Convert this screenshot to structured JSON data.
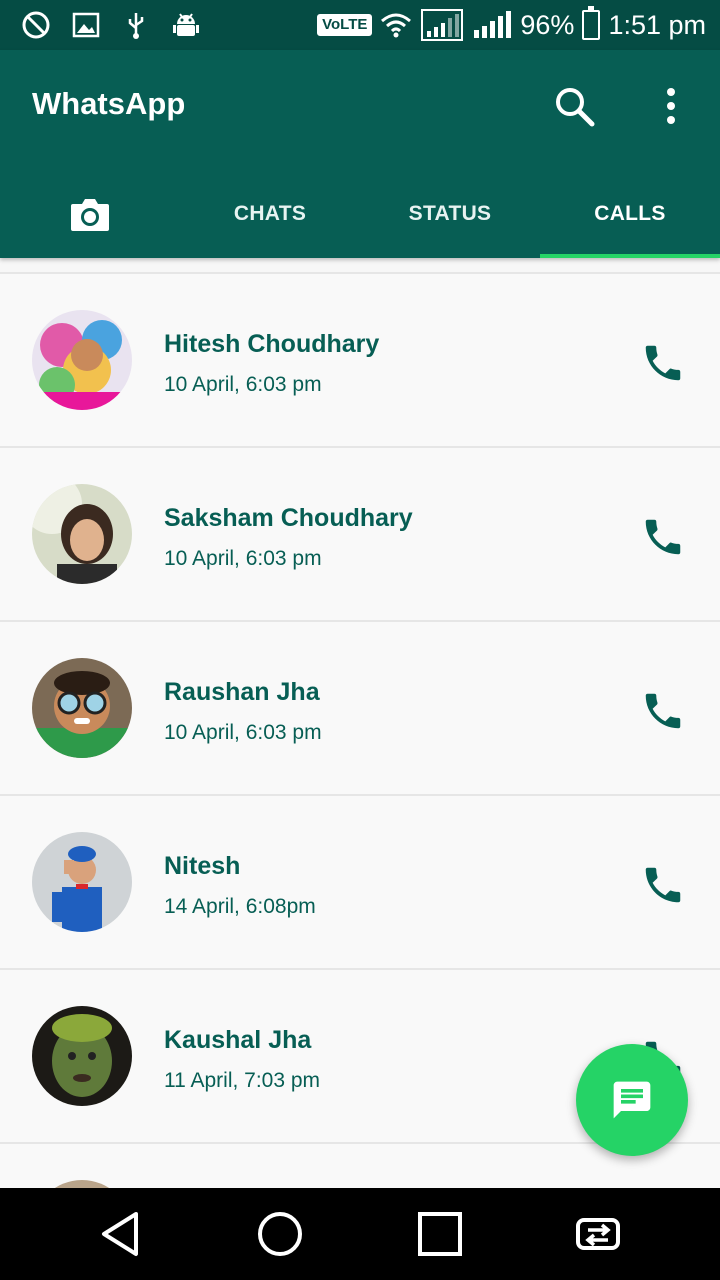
{
  "status_bar": {
    "volte": "VoLTE",
    "battery_percent": "96%",
    "time": "1:51 pm"
  },
  "app_bar": {
    "title": "WhatsApp",
    "tabs": [
      {
        "label": "",
        "icon": "camera-icon"
      },
      {
        "label": "CHATS"
      },
      {
        "label": "STATUS"
      },
      {
        "label": "CALLS",
        "active": true
      }
    ]
  },
  "calls": [
    {
      "name": "Hitesh Choudhary",
      "time": "10 April, 6:03 pm"
    },
    {
      "name": "Saksham Choudhary",
      "time": "10 April, 6:03 pm"
    },
    {
      "name": "Raushan Jha",
      "time": "10 April, 6:03 pm"
    },
    {
      "name": "Nitesh",
      "time": "14 April, 6:08pm"
    },
    {
      "name": "Kaushal Jha",
      "time": "11 April, 7:03 pm"
    }
  ],
  "colors": {
    "primary": "#075e54",
    "status_bar": "#054c44",
    "accent": "#25d366"
  }
}
